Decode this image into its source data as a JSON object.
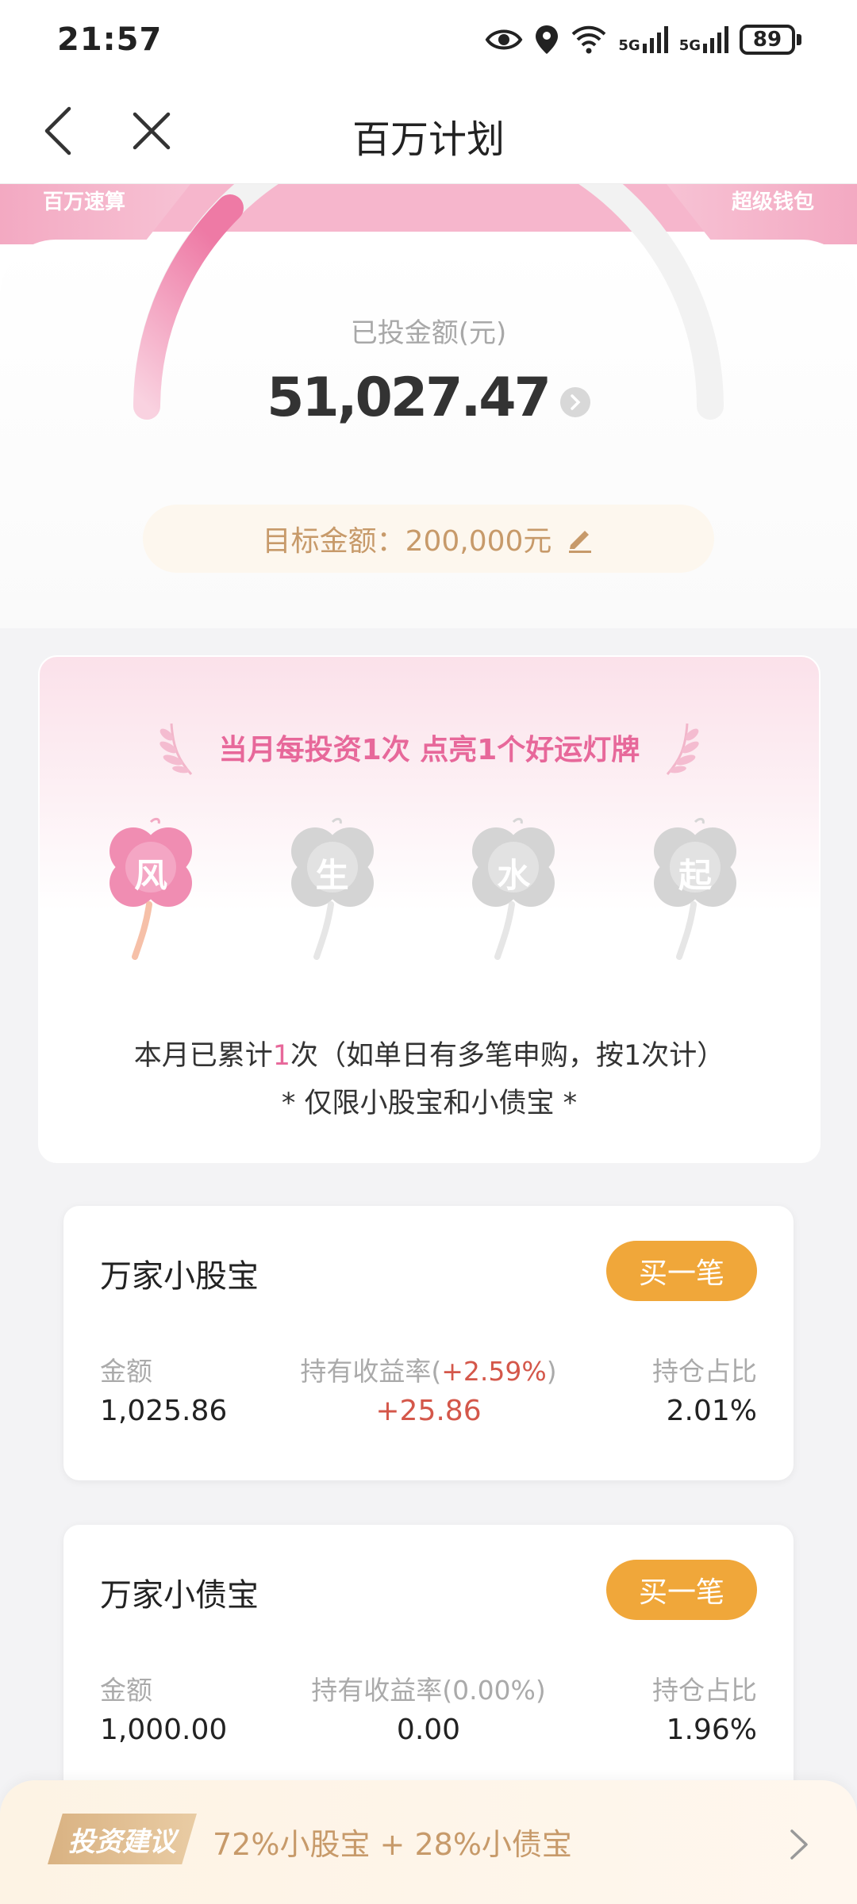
{
  "status_bar": {
    "time": "21:57",
    "net1": "5G",
    "net2": "5G",
    "battery": "89"
  },
  "nav": {
    "title": "百万计划"
  },
  "hero": {
    "corner_left": "百万速算",
    "corner_right": "超级钱包",
    "invested_label": "已投金额(元)",
    "invested_amount": "51,027.47",
    "target_label": "目标金额：200,000元"
  },
  "lucky": {
    "title": "当月每投资1次 点亮1个好运灯牌",
    "flowers": [
      {
        "char": "风",
        "lit": true
      },
      {
        "char": "生",
        "lit": false
      },
      {
        "char": "水",
        "lit": false
      },
      {
        "char": "起",
        "lit": false
      }
    ],
    "count_prefix": "本月已累计",
    "count_value": "1",
    "count_suffix": "次（如单日有多笔申购，按1次计）",
    "limit_note": "* 仅限小股宝和小债宝 *"
  },
  "funds": [
    {
      "name": "万家小股宝",
      "buy_label": "买一笔",
      "amount_label": "金额",
      "amount": "1,025.86",
      "yield_label_prefix": "持有收益率(",
      "yield_rate": "+2.59%",
      "yield_label_suffix": ")",
      "yield_value": "+25.86",
      "share_label": "持仓占比",
      "share": "2.01%"
    },
    {
      "name": "万家小债宝",
      "buy_label": "买一笔",
      "amount_label": "金额",
      "amount": "1,000.00",
      "yield_label_prefix": "持有收益率(",
      "yield_rate": "0.00%",
      "yield_label_suffix": ")",
      "yield_value": "0.00",
      "share_label": "持仓占比",
      "share": "1.96%"
    }
  ],
  "advice": {
    "badge": "投资建议",
    "text": "72%小股宝 + 28%小债宝"
  },
  "colors": {
    "accent_pink": "#e7689a",
    "gold": "#c79a6a",
    "buy_orange": "#f0a73a",
    "profit_red": "#d4574a"
  }
}
